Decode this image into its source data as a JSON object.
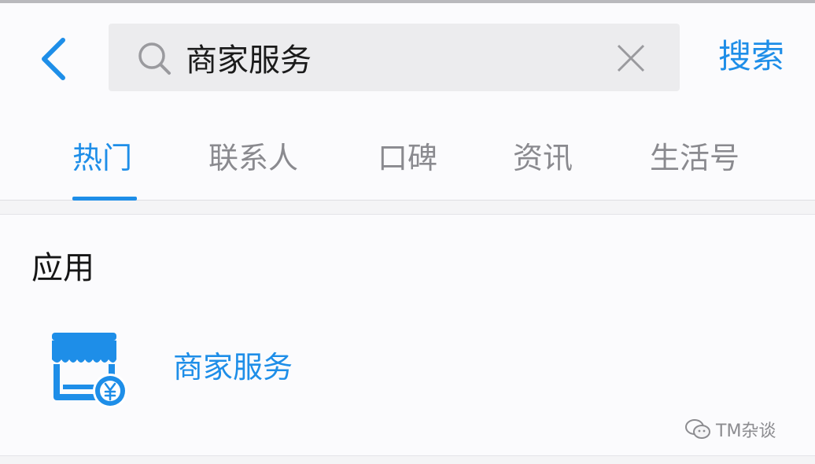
{
  "search": {
    "query": "商家服务",
    "submit_label": "搜索"
  },
  "tabs": [
    {
      "label": "热门",
      "active": true
    },
    {
      "label": "联系人",
      "active": false
    },
    {
      "label": "口碑",
      "active": false
    },
    {
      "label": "资讯",
      "active": false
    },
    {
      "label": "生活号",
      "active": false
    }
  ],
  "section": {
    "title": "应用"
  },
  "apps": [
    {
      "name": "商家服务",
      "icon": "storefront-yen-icon"
    }
  ],
  "watermark": {
    "text": "TM杂谈",
    "icon": "wechat-icon"
  },
  "colors": {
    "accent": "#1e8ee8",
    "tab_inactive": "#8a8a8f",
    "search_bg": "#ececee"
  }
}
